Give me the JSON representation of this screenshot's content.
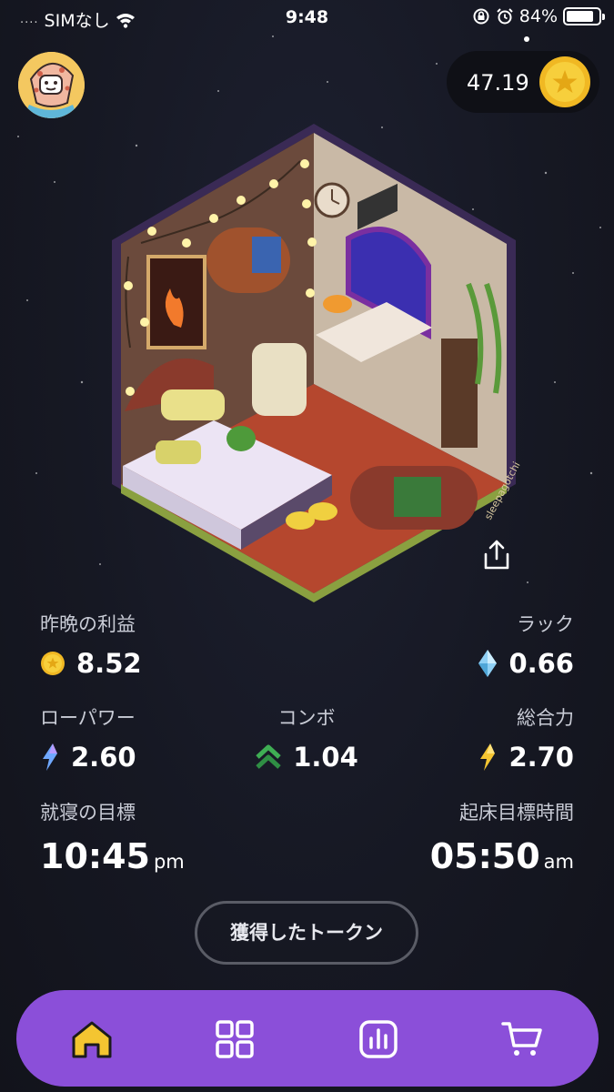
{
  "status_bar": {
    "signal_dots": "....",
    "carrier": "SIMなし",
    "time": "9:48",
    "battery_percent": "84%",
    "battery_level": 0.84,
    "icons": [
      "wifi-icon",
      "rotation-lock-icon",
      "alarm-icon",
      "battery-icon"
    ]
  },
  "header": {
    "avatar_icon": "avatar-character",
    "balance": "47.19",
    "coin_icon": "star-coin-icon"
  },
  "room": {
    "watermark": "sleepagotchi",
    "share_icon": "share-icon"
  },
  "stats": {
    "last_night_earnings": {
      "label": "昨晩の利益",
      "value": "8.52",
      "icon": "coin-icon"
    },
    "luck": {
      "label": "ラック",
      "value": "0.66",
      "icon": "diamond-icon"
    },
    "raw_power": {
      "label": "ローパワー",
      "value": "2.60",
      "icon": "lightning-blue-icon"
    },
    "combo": {
      "label": "コンボ",
      "value": "1.04",
      "icon": "double-chevron-up-icon"
    },
    "total_power": {
      "label": "総合力",
      "value": "2.70",
      "icon": "lightning-yellow-icon"
    }
  },
  "sleep_goal": {
    "label": "就寝の目標",
    "time": "10:45",
    "ampm": "pm"
  },
  "wake_goal": {
    "label": "起床目標時間",
    "time": "05:50",
    "ampm": "am"
  },
  "tokens_button": {
    "label": "獲得したトークン"
  },
  "nav": {
    "items": [
      {
        "name": "home",
        "icon": "home-icon"
      },
      {
        "name": "grid",
        "icon": "grid-icon"
      },
      {
        "name": "stats",
        "icon": "bar-chart-icon"
      },
      {
        "name": "shop",
        "icon": "cart-icon"
      }
    ]
  },
  "colors": {
    "background": "#161823",
    "nav_purple": "#8b4fd9",
    "coin_gold": "#f5c531",
    "combo_green": "#3fae54",
    "lightning_blue": "#6fa8ff",
    "lightning_yellow": "#f5c531"
  }
}
